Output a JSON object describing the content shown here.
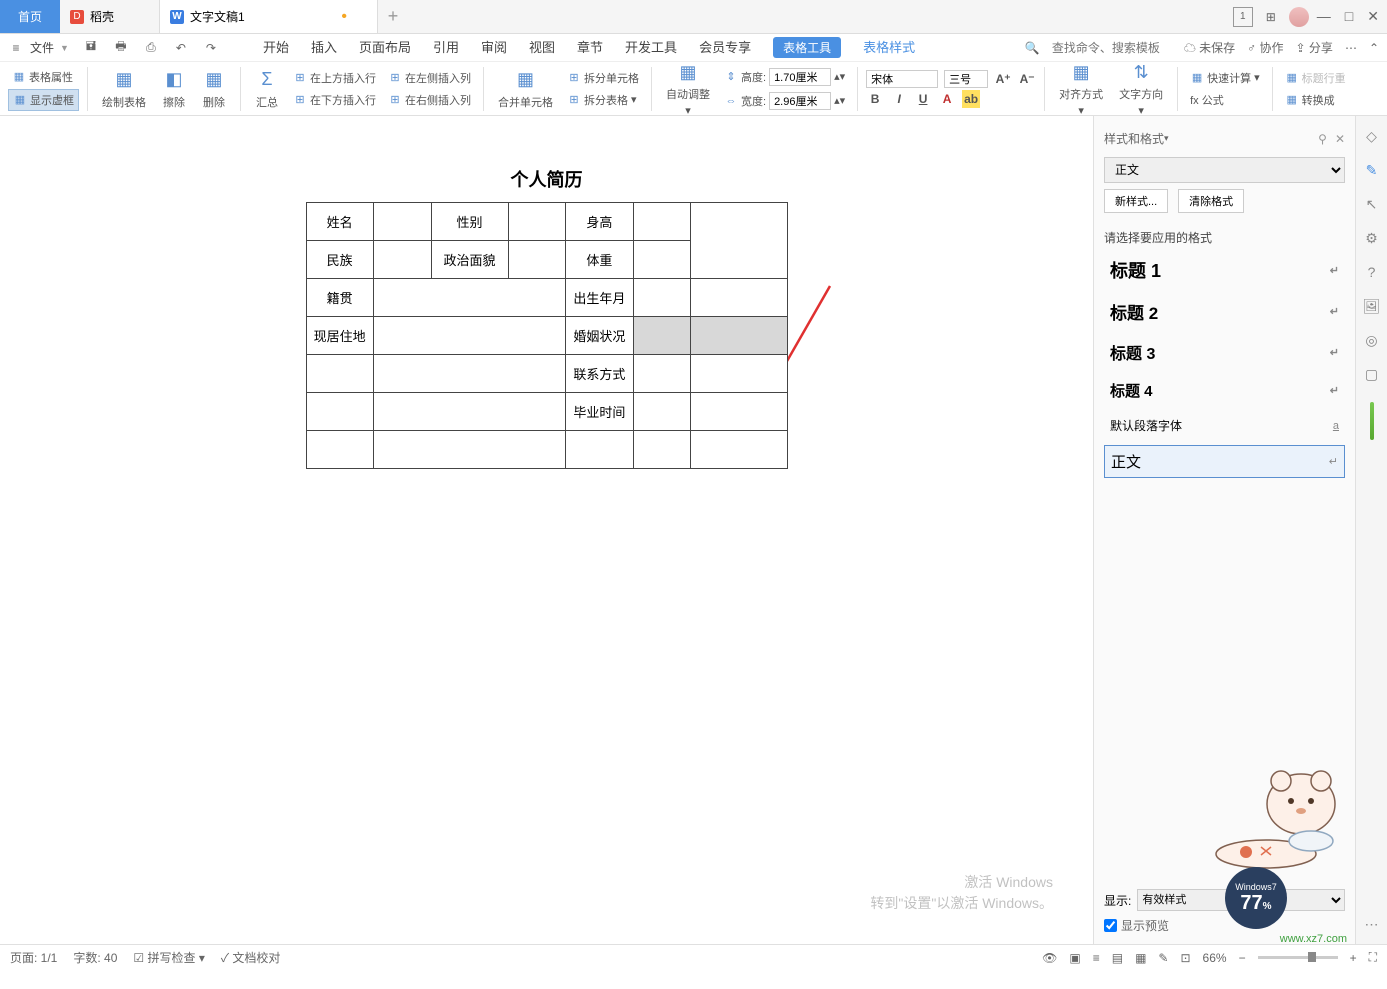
{
  "titlebar": {
    "home": "首页",
    "shell": "稻壳",
    "doc_name": "文字文稿1",
    "add": "+"
  },
  "quickbar": {
    "file_label": "文件",
    "menus": [
      "开始",
      "插入",
      "页面布局",
      "引用",
      "审阅",
      "视图",
      "章节",
      "开发工具",
      "会员专享"
    ],
    "table_tools": "表格工具",
    "table_style": "表格样式",
    "search_placeholder": "查找命令、搜索模板",
    "unsaved": "未保存",
    "collab": "协作",
    "share": "分享"
  },
  "ribbon": {
    "table_prop": "表格属性",
    "show_border": "显示虚框",
    "draw_table": "绘制表格",
    "erase": "擦除",
    "delete": "删除",
    "summary": "汇总",
    "ins_row_above": "在上方插入行",
    "ins_row_below": "在下方插入行",
    "ins_col_left": "在左侧插入列",
    "ins_col_right": "在右侧插入列",
    "merge_cells": "合并单元格",
    "split_cells": "拆分单元格",
    "split_table": "拆分表格",
    "auto_adjust": "自动调整",
    "height_label": "高度:",
    "height_val": "1.70厘米",
    "width_label": "宽度:",
    "width_val": "2.96厘米",
    "font_name": "宋体",
    "font_size": "三号",
    "align": "对齐方式",
    "text_dir": "文字方向",
    "fast_calc": "快速计算",
    "formula": "fx 公式",
    "header_row": "标题行重",
    "convert": "转换成"
  },
  "document": {
    "title": "个人简历",
    "rows": [
      [
        "姓名",
        "",
        "性别",
        "",
        "身高",
        "",
        ""
      ],
      [
        "民族",
        "",
        "政治面貌",
        "",
        "体重",
        "",
        ""
      ],
      [
        "籍贯",
        "",
        "",
        "",
        "出生年月",
        "",
        ""
      ],
      [
        "现居住地",
        "",
        "",
        "",
        "婚姻状况",
        "",
        ""
      ],
      [
        "",
        "",
        "",
        "",
        "联系方式",
        "",
        ""
      ],
      [
        "",
        "",
        "",
        "",
        "毕业时间",
        "",
        ""
      ],
      [
        "",
        "",
        "",
        "",
        "",
        "",
        ""
      ]
    ]
  },
  "sidepanel": {
    "title": "样式和格式",
    "current": "正文",
    "new_style": "新样式...",
    "clear_fmt": "清除格式",
    "choose_label": "请选择要应用的格式",
    "styles": [
      {
        "name": "标题 1",
        "cls": ""
      },
      {
        "name": "标题 2",
        "cls": ""
      },
      {
        "name": "标题 3",
        "cls": ""
      },
      {
        "name": "标题 4",
        "cls": ""
      },
      {
        "name": "默认段落字体",
        "cls": "small"
      },
      {
        "name": "正文",
        "cls": "sel"
      }
    ],
    "show_label": "显示:",
    "show_val": "有效样式",
    "preview_label": "显示预览"
  },
  "statusbar": {
    "page": "页面: 1/1",
    "words": "字数: 40",
    "spell": "拼写检查",
    "proof": "文档校对",
    "zoom": "66%"
  },
  "watermark": {
    "line1": "激活 Windows",
    "line2": "转到\"设置\"以激活 Windows。"
  },
  "widget": {
    "label": "Windows7",
    "percent": "77",
    "site": "www.xz7.com"
  }
}
